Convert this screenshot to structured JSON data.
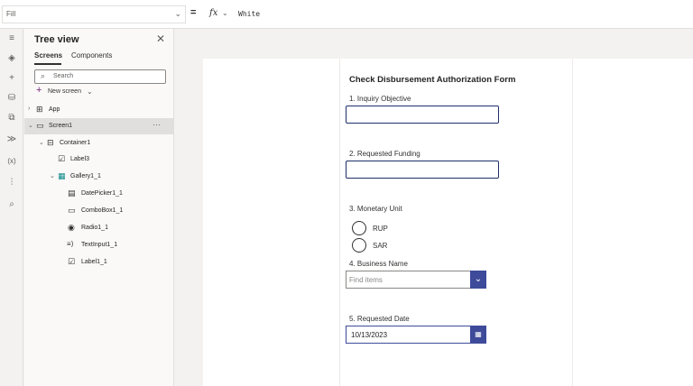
{
  "formula_bar": {
    "property": "Fill",
    "equals": "=",
    "fx": "fx",
    "formula": "White"
  },
  "rail": {
    "icons": [
      "hamburger-icon",
      "layers-icon",
      "insert-icon",
      "data-icon",
      "media-icon",
      "power-automate-icon",
      "variables-icon",
      "settings-icon",
      "search-icon"
    ],
    "variables_label": "(x)"
  },
  "tree_view": {
    "title": "Tree view",
    "close": "✕",
    "tabs": {
      "screens": "Screens",
      "components": "Components"
    },
    "search_placeholder": "Search",
    "new_screen": "New screen",
    "nodes": {
      "app": "App",
      "screen1": "Screen1",
      "container1": "Container1",
      "label3": "Label3",
      "gallery1_1": "Gallery1_1",
      "datepicker1_1": "DatePicker1_1",
      "combobox1_1": "ComboBox1_1",
      "radio1_1": "Radio1_1",
      "textinput1_1": "TextInput1_1",
      "label1_1": "Label1_1"
    },
    "more": "···"
  },
  "form": {
    "title": "Check Disbursement Authorization Form",
    "q1": "1. Inquiry Objective",
    "q2": "2. Requested Funding",
    "q3": "3. Monetary Unit",
    "radio_options": [
      "RUP",
      "SAR"
    ],
    "q4": "4. Business Name",
    "combobox_placeholder": "Find items",
    "q5": "5. Requested Date",
    "date_value": "10/13/2023"
  },
  "colors": {
    "accent": "#3e4b9a",
    "input_border": "#1f2f6b",
    "brand_purple": "#742774"
  }
}
